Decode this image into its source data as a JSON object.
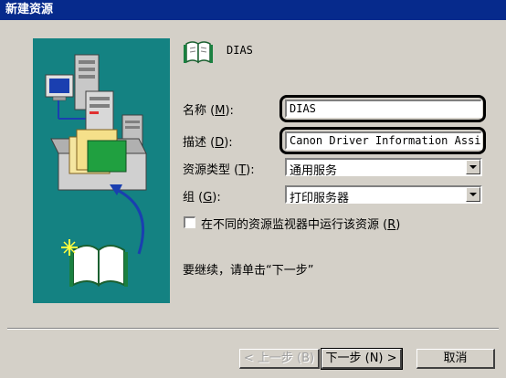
{
  "window": {
    "title": "新建资源"
  },
  "header": {
    "icon": "book-icon",
    "resource_name": "DIAS"
  },
  "form": {
    "name": {
      "label_pre": "名称 (",
      "accel": "M",
      "label_post": "):",
      "value": "DIAS"
    },
    "description": {
      "label_pre": "描述 (",
      "accel": "D",
      "label_post": "):",
      "value": "Canon Driver Information Assi:"
    },
    "resource_type": {
      "label_pre": "资源类型 (",
      "accel": "T",
      "label_post": "):",
      "value": "通用服务"
    },
    "group": {
      "label_pre": "组 (",
      "accel": "G",
      "label_post": "):",
      "value": "打印服务器"
    },
    "separate_monitor": {
      "label_pre": "在不同的资源监视器中运行该资源 (",
      "accel": "R",
      "label_post": ")",
      "checked": false
    }
  },
  "instruction": "要继续，请单击“下一步”",
  "buttons": {
    "back": "< 上一步 (B)",
    "next": "下一步 (N) >",
    "cancel": "取消"
  },
  "colors": {
    "titlebar": "#062a8c",
    "dialog": "#d4d0c8",
    "panel": "#148282",
    "highlight_ring": "#000000"
  }
}
